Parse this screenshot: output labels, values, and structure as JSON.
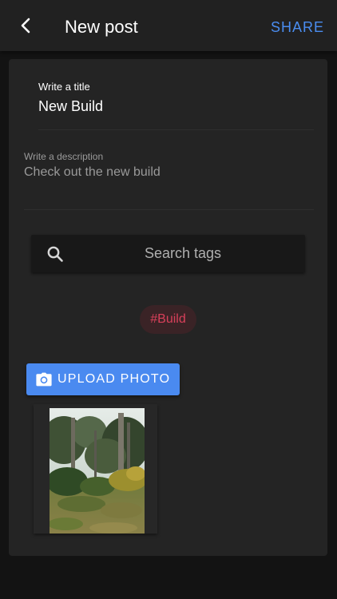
{
  "appbar": {
    "title": "New post",
    "share_label": "SHARE",
    "back_icon": "chevron-left-icon"
  },
  "form": {
    "title_label": "Write a title",
    "title_value": "New Build",
    "description_label": "Write a description",
    "description_value": "Check out the new build"
  },
  "search": {
    "placeholder": "Search tags",
    "icon": "search-icon"
  },
  "tags": [
    "#Build"
  ],
  "upload": {
    "label": "UPLOAD PHOTO",
    "icon": "camera-icon"
  },
  "colors": {
    "accent": "#4a8af0",
    "tag_text": "#d8405a",
    "tag_background": "#3a2326",
    "surface": "#242424",
    "background": "#131313"
  }
}
